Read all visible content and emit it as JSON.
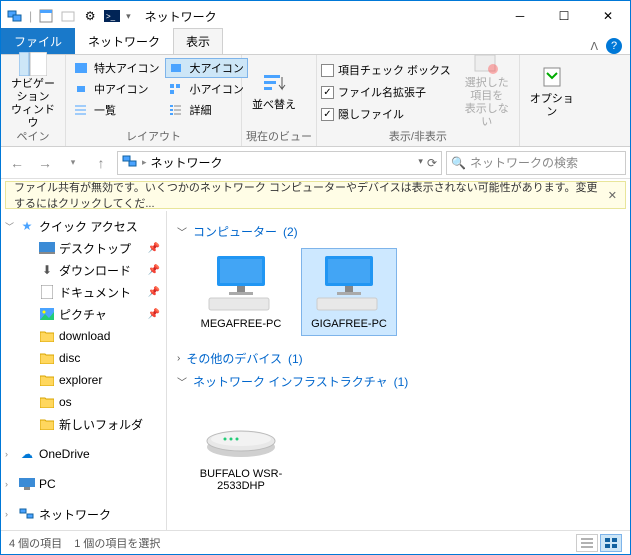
{
  "window": {
    "title": "ネットワーク"
  },
  "tabs": {
    "file": "ファイル",
    "network": "ネットワーク",
    "view": "表示"
  },
  "ribbon": {
    "pane": {
      "label": "ペイン",
      "nav": "ナビゲーション\nウィンドウ"
    },
    "layout": {
      "label": "レイアウト",
      "items": [
        "特大アイコン",
        "大アイコン",
        "中アイコン",
        "小アイコン",
        "一覧",
        "詳細"
      ]
    },
    "currentview": {
      "label": "現在のビュー",
      "sort": "並べ替え"
    },
    "showhide": {
      "label": "表示/非表示",
      "cb1": "項目チェック ボックス",
      "cb2": "ファイル名拡張子",
      "cb3": "隠しファイル",
      "hideSel": "選択した項目を\n表示しない"
    },
    "options": "オプション"
  },
  "address": {
    "location": "ネットワーク"
  },
  "search": {
    "placeholder": "ネットワークの検索"
  },
  "infobar": {
    "text": "ファイル共有が無効です。いくつかのネットワーク コンピューターやデバイスは表示されない可能性があります。変更するにはクリックしてくだ..."
  },
  "nav": {
    "quick": "クイック アクセス",
    "desktop": "デスクトップ",
    "downloads": "ダウンロード",
    "documents": "ドキュメント",
    "pictures": "ピクチャ",
    "folders": [
      "download",
      "disc",
      "explorer",
      "os",
      "新しいフォルダ"
    ],
    "onedrive": "OneDrive",
    "pc": "PC",
    "network": "ネットワーク"
  },
  "groups": {
    "computers": {
      "label": "コンピューター",
      "count": "(2)",
      "items": [
        "MEGAFREE-PC",
        "GIGAFREE-PC"
      ]
    },
    "other": {
      "label": "その他のデバイス",
      "count": "(1)"
    },
    "infra": {
      "label": "ネットワーク インフラストラクチャ",
      "count": "(1)",
      "items": [
        "BUFFALO WSR-2533DHP"
      ]
    }
  },
  "status": {
    "count": "4 個の項目",
    "selected": "1 個の項目を選択"
  }
}
